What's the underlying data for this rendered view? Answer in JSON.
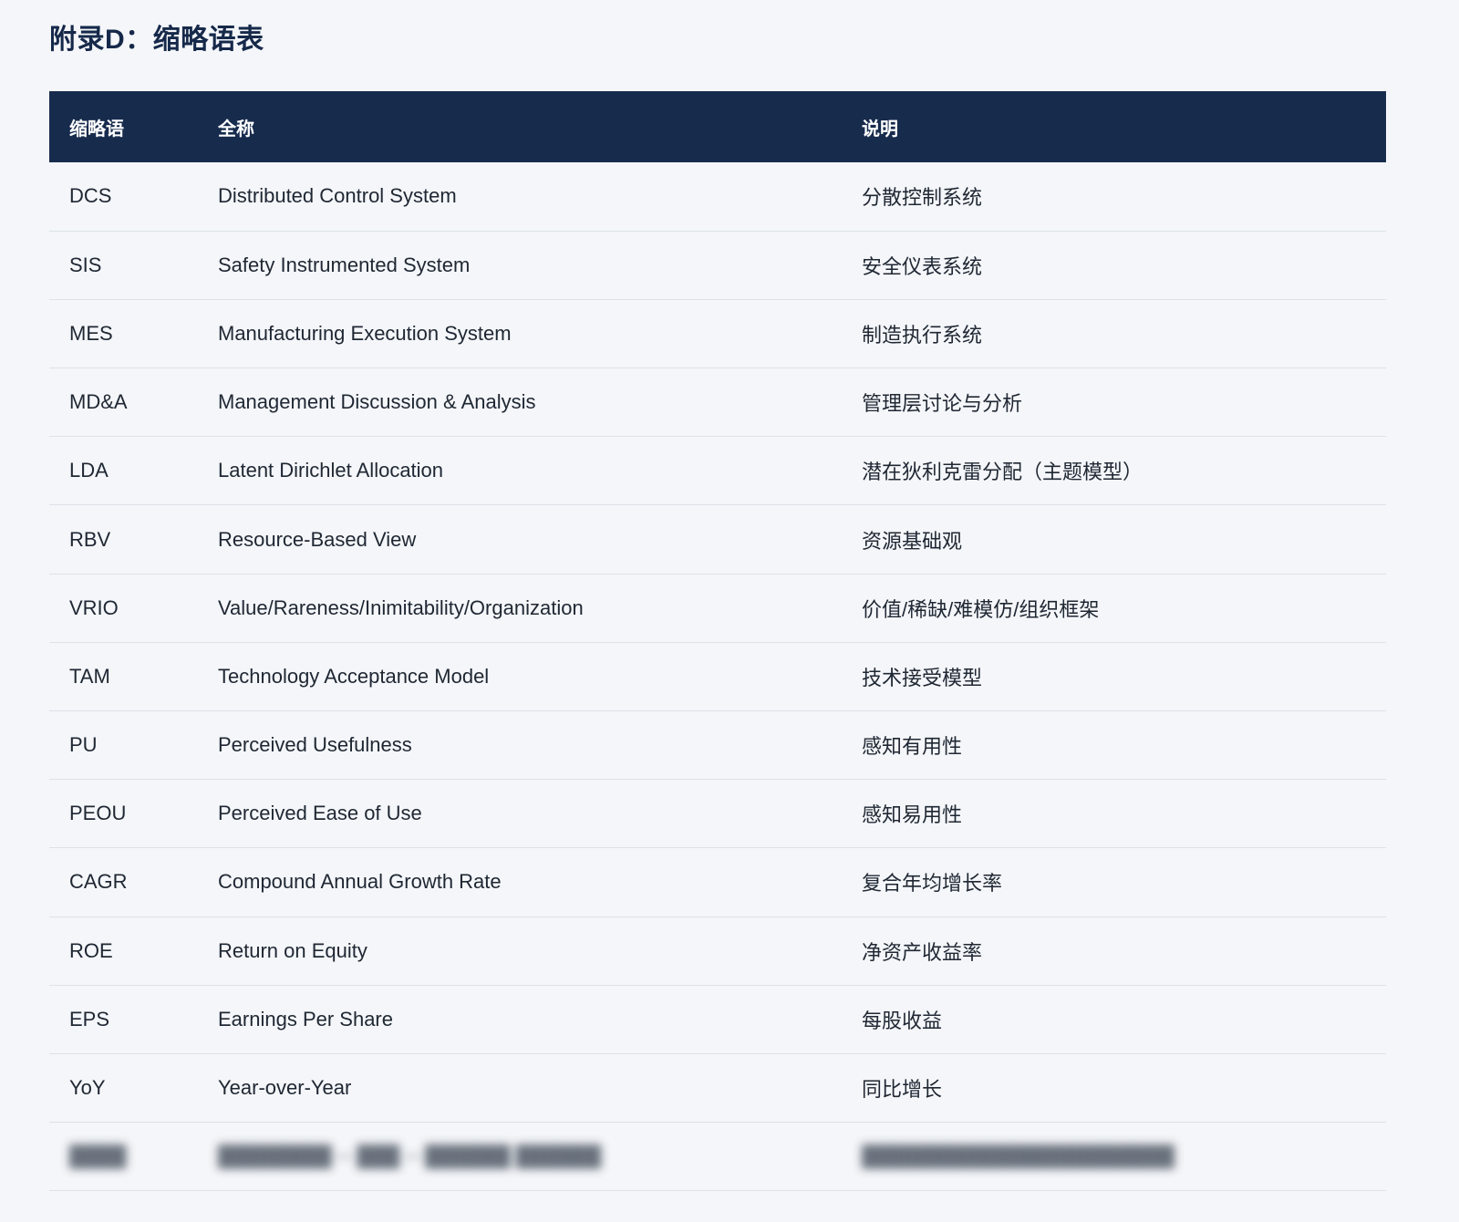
{
  "page": {
    "title": "附录D：缩略语表"
  },
  "table": {
    "headers": {
      "abbr": "缩略语",
      "full": "全称",
      "desc": "说明"
    },
    "rows": [
      {
        "abbr": "DCS",
        "full": "Distributed Control System",
        "desc": "分散控制系统"
      },
      {
        "abbr": "SIS",
        "full": "Safety Instrumented System",
        "desc": "安全仪表系统"
      },
      {
        "abbr": "MES",
        "full": "Manufacturing Execution System",
        "desc": "制造执行系统"
      },
      {
        "abbr": "MD&A",
        "full": "Management Discussion & Analysis",
        "desc": "管理层讨论与分析"
      },
      {
        "abbr": "LDA",
        "full": "Latent Dirichlet Allocation",
        "desc": "潜在狄利克雷分配（主题模型）"
      },
      {
        "abbr": "RBV",
        "full": "Resource-Based View",
        "desc": "资源基础观"
      },
      {
        "abbr": "VRIO",
        "full": "Value/Rareness/Inimitability/Organization",
        "desc": "价值/稀缺/难模仿/组织框架"
      },
      {
        "abbr": "TAM",
        "full": "Technology Acceptance Model",
        "desc": "技术接受模型"
      },
      {
        "abbr": "PU",
        "full": "Perceived Usefulness",
        "desc": "感知有用性"
      },
      {
        "abbr": "PEOU",
        "full": "Perceived Ease of Use",
        "desc": "感知易用性"
      },
      {
        "abbr": "CAGR",
        "full": "Compound Annual Growth Rate",
        "desc": "复合年均增长率"
      },
      {
        "abbr": "ROE",
        "full": "Return on Equity",
        "desc": "净资产收益率"
      },
      {
        "abbr": "EPS",
        "full": "Earnings Per Share",
        "desc": "每股收益"
      },
      {
        "abbr": "YoY",
        "full": "Year-over-Year",
        "desc": "同比增长"
      }
    ]
  }
}
